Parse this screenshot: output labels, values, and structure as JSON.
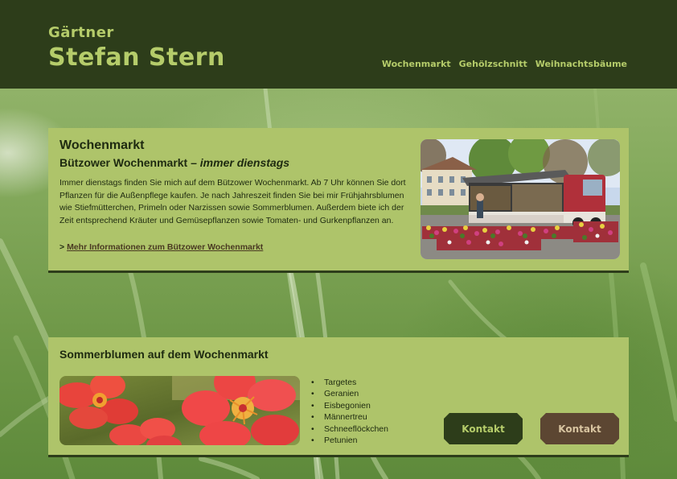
{
  "header": {
    "brand_sub": "Gärtner",
    "brand_name": "Stefan Stern",
    "nav": [
      "Wochenmarkt",
      "Gehölzschnitt",
      "Weihnachtsbäume"
    ]
  },
  "market": {
    "title": "Wochenmarkt",
    "subtitle_main": "Bützower Wochenmarkt – ",
    "subtitle_em": "immer dienstags",
    "text": "Immer dienstags finden Sie mich auf dem Bützower Wochenmarkt. Ab 7 Uhr können Sie dort Pflanzen für die Außenpflege kaufen. Je nach Jahreszeit finden Sie bei mir Frühjahrsblumen wie Stiefmütterchen, Primeln oder Narzissen sowie Sommerblumen. Außerdem biete ich der Zeit entsprechend Kräuter und Gemüsepflanzen sowie Tomaten- und Gurkenpflanzen an.",
    "link_prefix": "> ",
    "link_label": "Mehr Informationen zum Bützower Wochenmarkt"
  },
  "summer": {
    "title": "Sommerblumen auf dem Wochenmarkt",
    "items": [
      "Targetes",
      "Geranien",
      "Eisbegonien",
      "Männertreu",
      "Schneeflöckchen",
      "Petunien"
    ],
    "button_primary": "Kontakt",
    "button_secondary": "Kontakt"
  },
  "colors": {
    "header_bg": "#2d3d1a",
    "accent_lime": "#b5cc6a",
    "panel_bg": "#aec46a",
    "button_brown": "#5c4632"
  }
}
